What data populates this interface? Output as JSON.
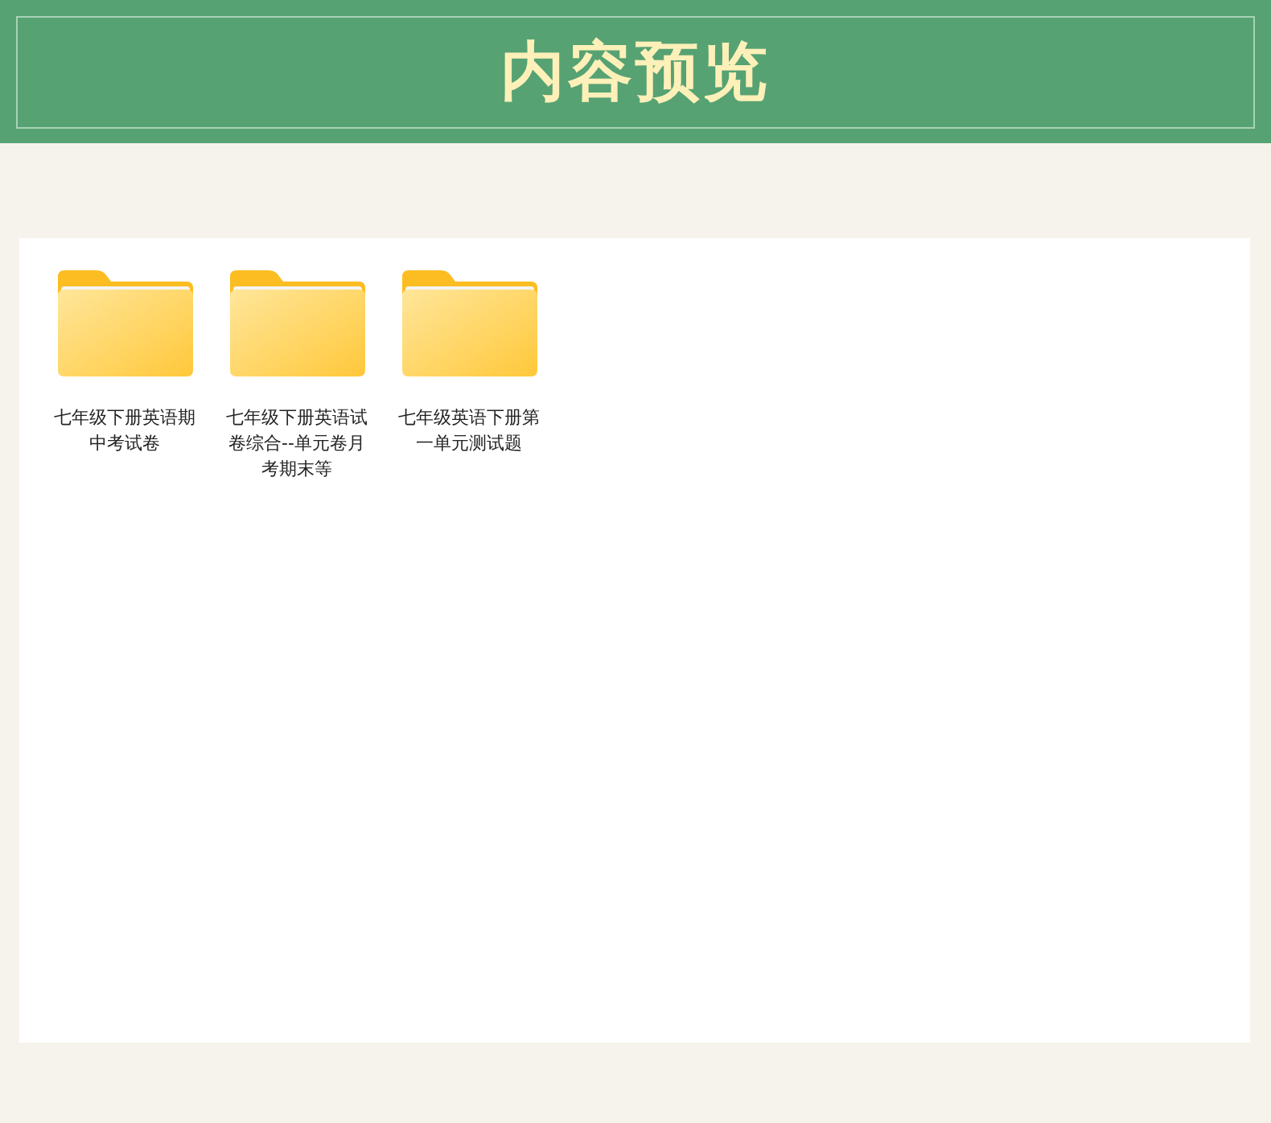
{
  "header": {
    "title": "内容预览"
  },
  "folders": [
    {
      "name": "七年级下册英语期中考试卷"
    },
    {
      "name": "七年级下册英语试卷综合--单元卷月考期末等"
    },
    {
      "name": "七年级英语下册第一单元测试题"
    }
  ]
}
